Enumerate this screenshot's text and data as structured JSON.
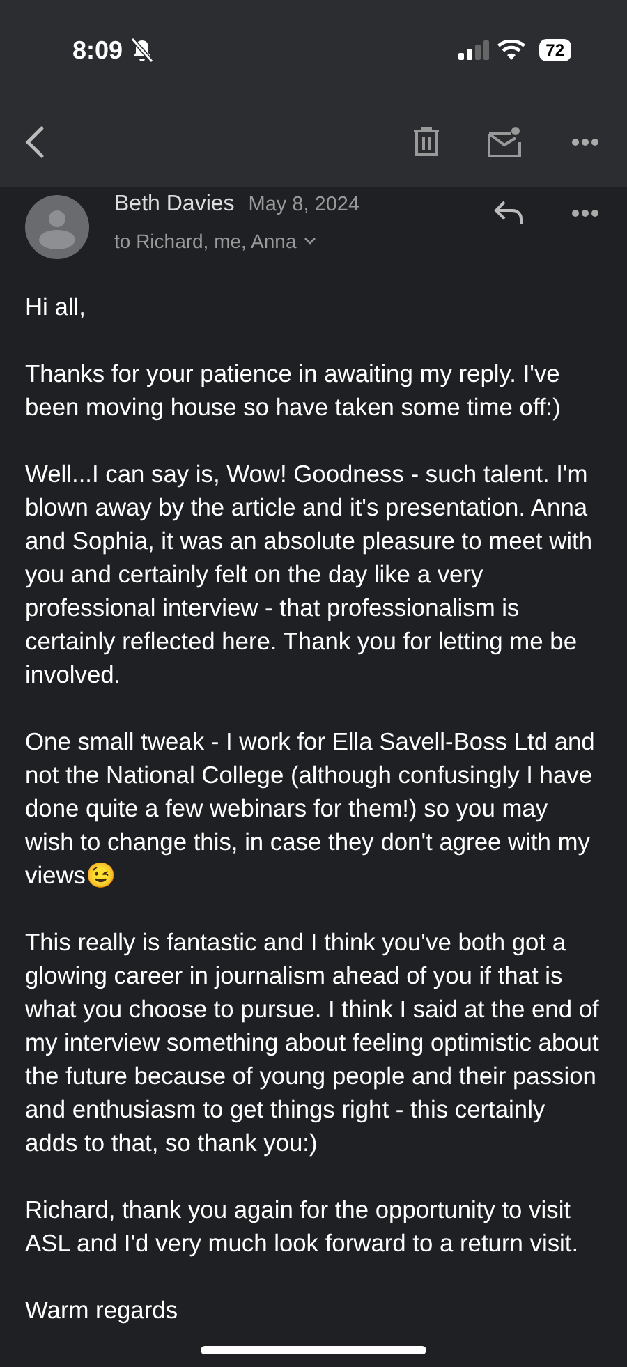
{
  "status_bar": {
    "time": "8:09",
    "battery": "72"
  },
  "message": {
    "sender": "Beth Davies",
    "date": "May 8, 2024",
    "recipients": "to Richard, me, Anna",
    "paragraphs": [
      "Hi all,",
      "Thanks for your patience in awaiting my reply. I've been moving house so have taken some time off:)",
      "Well...I can say is, Wow! Goodness - such talent. I'm blown away by the article and it's presentation. Anna and Sophia, it was an absolute pleasure to meet with you and certainly felt on the day like a very professional interview - that professionalism is certainly reflected here. Thank you for letting me be involved.",
      "One small tweak - I work for Ella Savell-Boss Ltd and not the National College (although confusingly I have done quite a few webinars for them!) so you may wish to change this, in case they don't agree with my views😉",
      "This really is fantastic and I think you've both got a glowing career in journalism ahead of you if that is what you choose to pursue. I think I said at the end of my interview something about feeling optimistic about the future because of young people and their passion and enthusiasm to get things right - this certainly adds to that, so thank you:)",
      "Richard, thank you again for the opportunity to visit ASL and I'd very much look forward to a return visit.",
      "Warm regards"
    ]
  }
}
